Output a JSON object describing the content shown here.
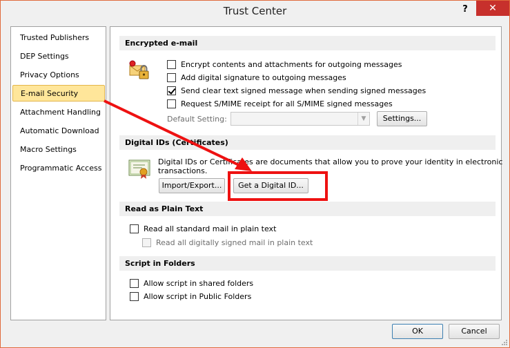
{
  "window": {
    "title": "Trust Center",
    "help": "?",
    "close": "✕"
  },
  "sidebar": {
    "items": [
      {
        "label": "Trusted Publishers"
      },
      {
        "label": "DEP Settings"
      },
      {
        "label": "Privacy Options"
      },
      {
        "label": "E-mail Security",
        "selected": true
      },
      {
        "label": "Attachment Handling"
      },
      {
        "label": "Automatic Download"
      },
      {
        "label": "Macro Settings"
      },
      {
        "label": "Programmatic Access"
      }
    ]
  },
  "encrypted": {
    "header": "Encrypted e-mail",
    "options": [
      {
        "label": "Encrypt contents and attachments for outgoing messages",
        "checked": false
      },
      {
        "label": "Add digital signature to outgoing messages",
        "checked": false
      },
      {
        "label": "Send clear text signed message when sending signed messages",
        "checked": true
      },
      {
        "label": "Request S/MIME receipt for all S/MIME signed messages",
        "checked": false
      }
    ],
    "default_setting_label": "Default Setting:",
    "default_setting_value": "",
    "settings_button": "Settings..."
  },
  "digital_ids": {
    "header": "Digital IDs (Certificates)",
    "description_line1": "Digital IDs or Certificates are documents that allow you to prove your identity in electronic",
    "description_line2": "transactions.",
    "import_export_button": "Import/Export...",
    "get_digital_id_button": "Get a Digital ID..."
  },
  "plain_text": {
    "header": "Read as Plain Text",
    "options": [
      {
        "label": "Read all standard mail in plain text",
        "checked": false,
        "disabled": false
      },
      {
        "label": "Read all digitally signed mail in plain text",
        "checked": false,
        "disabled": true
      }
    ]
  },
  "script_folders": {
    "header": "Script in Folders",
    "options": [
      {
        "label": "Allow script in shared folders",
        "checked": false
      },
      {
        "label": "Allow script in Public Folders",
        "checked": false
      }
    ]
  },
  "footer": {
    "ok": "OK",
    "cancel": "Cancel"
  },
  "colors": {
    "selected_bg": "#ffe69a",
    "annotation_red": "#ee1111",
    "close_red": "#c7302c"
  }
}
